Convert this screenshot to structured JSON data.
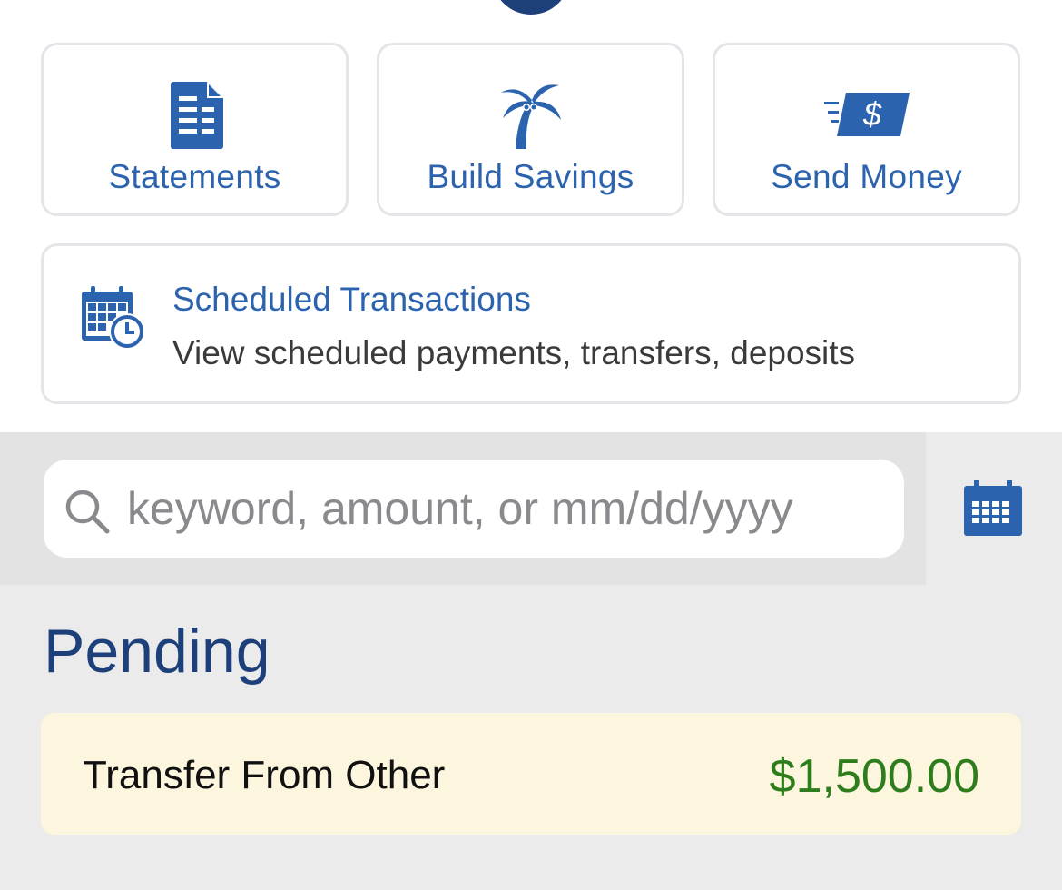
{
  "quick_actions": [
    {
      "label": "Statements",
      "icon": "document-icon"
    },
    {
      "label": "Build Savings",
      "icon": "palm-tree-icon"
    },
    {
      "label": "Send Money",
      "icon": "money-send-icon"
    }
  ],
  "scheduled": {
    "title": "Scheduled Transactions",
    "subtitle": "View scheduled payments, transfers, deposits",
    "icon": "calendar-clock-icon"
  },
  "search": {
    "placeholder": "keyword, amount, or mm/dd/yyyy",
    "value": ""
  },
  "pending": {
    "title": "Pending",
    "transactions": [
      {
        "description": "Transfer From Other",
        "amount": "$1,500.00"
      }
    ]
  },
  "colors": {
    "brand_blue": "#2c63ae",
    "navy": "#1d3f7a",
    "positive_amount": "#2e7d1d",
    "pending_bg": "#fbf6dd"
  }
}
